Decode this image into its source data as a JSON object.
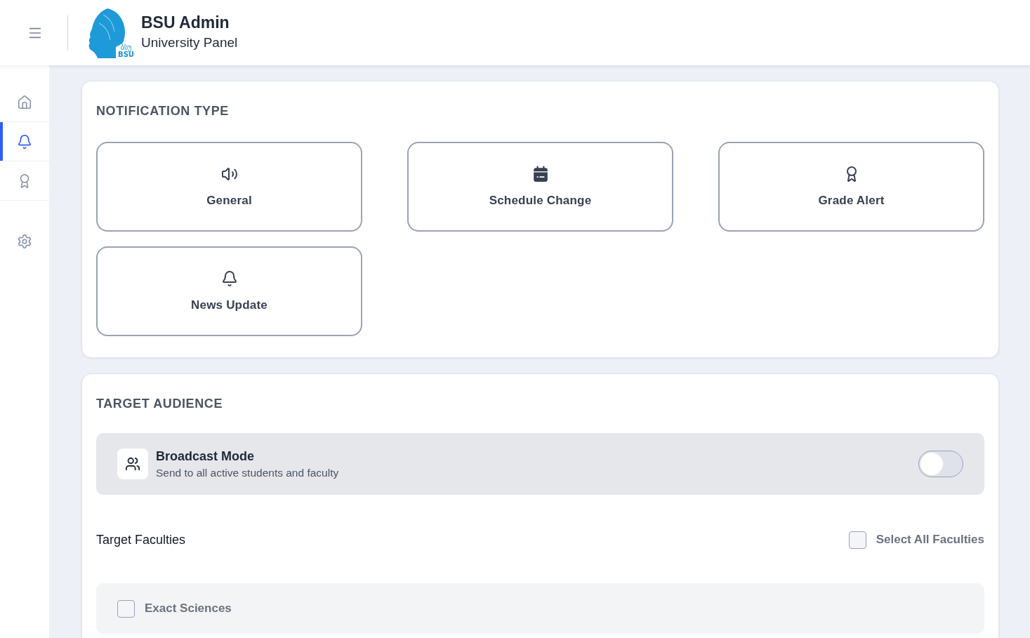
{
  "header": {
    "logo_text": [
      "ბსუ",
      "BSU"
    ],
    "title": "BSU Admin",
    "subtitle": "University Panel"
  },
  "sidebar": {
    "items": [
      {
        "selected": false
      },
      {
        "selected": true
      },
      {
        "selected": false
      }
    ],
    "bottom_items": [
      {
        "selected": false
      }
    ]
  },
  "notification_type": {
    "heading": "NOTIFICATION TYPE",
    "options": [
      {
        "label": "General",
        "selected": false
      },
      {
        "label": "Schedule Change",
        "selected": false
      },
      {
        "label": "Grade Alert",
        "selected": false
      },
      {
        "label": "News Update",
        "selected": false
      }
    ]
  },
  "target_audience": {
    "heading": "TARGET AUDIENCE",
    "broadcast": {
      "title": "Broadcast Mode",
      "description": "Send to all active students and faculty",
      "on": false
    },
    "faculties_label": "Target Faculties",
    "select_all": {
      "label": "Select All Faculties",
      "checked": false
    },
    "faculties": [
      {
        "name": "Exact Sciences",
        "checked": false
      }
    ]
  }
}
